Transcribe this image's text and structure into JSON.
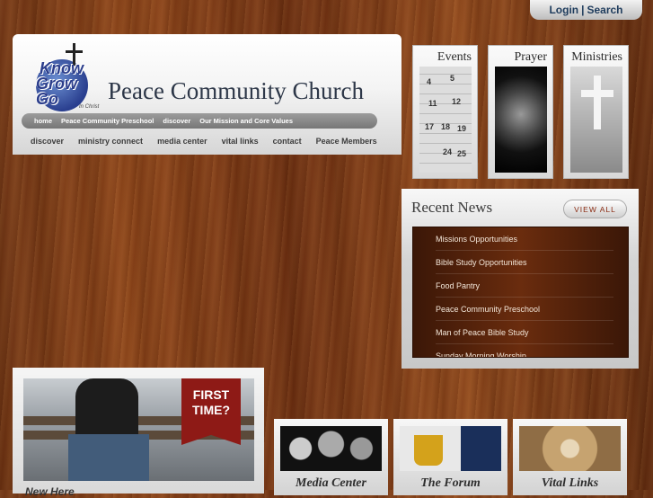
{
  "top": {
    "login": "Login",
    "separator": "|",
    "search": "Search"
  },
  "header": {
    "title": "Peace Community Church",
    "logo": {
      "line1": "Know",
      "line2": "Grow",
      "line3": "Go",
      "tag": "In Christ"
    },
    "subnav": [
      "home",
      "Peace Community Preschool",
      "discover",
      "Our Mission and Core Values"
    ],
    "mainnav": [
      "discover",
      "ministry connect",
      "media center",
      "vital links",
      "contact",
      "Peace Members"
    ]
  },
  "features": [
    {
      "title": "Events"
    },
    {
      "title": "Prayer"
    },
    {
      "title": "Ministries"
    }
  ],
  "calendar_numbers": [
    "4",
    "5",
    "11",
    "12",
    "17",
    "18",
    "19",
    "24",
    "25"
  ],
  "news": {
    "title": "Recent News",
    "view_all": "VIEW ALL",
    "items": [
      "Missions Opportunities",
      "Bible Study Opportunities",
      "Food Pantry",
      "Peace Community Preschool",
      "Man of Peace Bible Study",
      "Sunday Morning Worship"
    ]
  },
  "first_time": {
    "ribbon_line1": "FIRST",
    "ribbon_line2": "TIME?",
    "caption": "New Here"
  },
  "bottom_tiles": [
    "Media Center",
    "The Forum",
    "Vital Links"
  ]
}
